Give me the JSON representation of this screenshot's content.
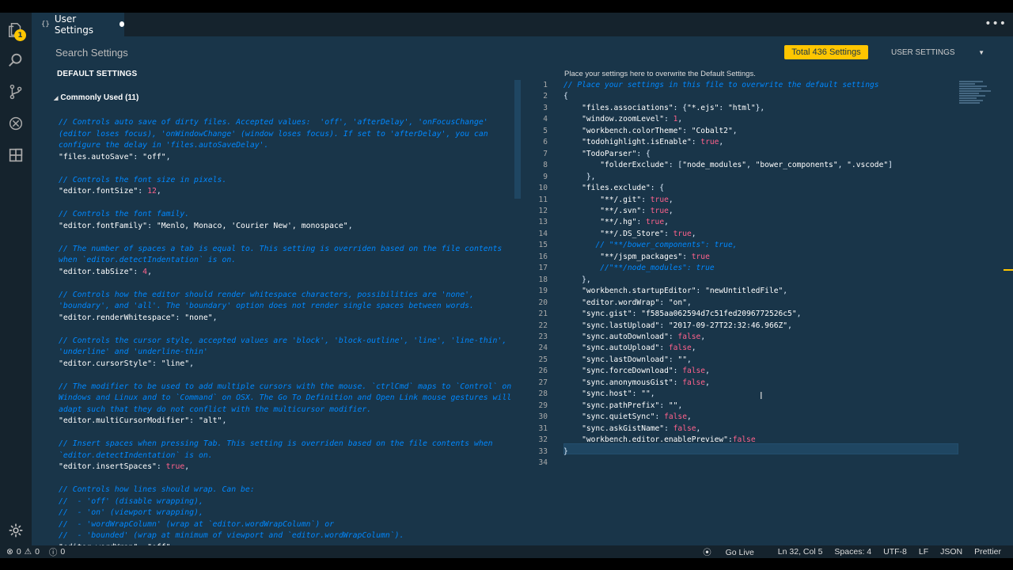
{
  "tab": {
    "label": "User Settings",
    "icon_text": "{}"
  },
  "search": {
    "placeholder": "Search Settings"
  },
  "toolbar": {
    "total_label": "Total 436 Settings",
    "scope_label": "USER SETTINGS"
  },
  "activity_badge": "1",
  "left": {
    "header": "DEFAULT SETTINGS",
    "group_label": "Commonly Used (11)",
    "lines": [
      {
        "t": "cm",
        "v": "// Controls auto save of dirty files. Accepted values:  'off', 'afterDelay', 'onFocusChange'"
      },
      {
        "t": "cm",
        "v": "(editor loses focus), 'onWindowChange' (window loses focus). If set to 'afterDelay', you can"
      },
      {
        "t": "cm",
        "v": "configure the delay in 'files.autoSaveDelay'."
      },
      {
        "t": "kv",
        "k": "\"files.autoSave\"",
        "s": ": ",
        "v": "\"off\"",
        "vt": "p-str",
        "e": ","
      },
      {
        "t": "blank",
        "v": ""
      },
      {
        "t": "cm",
        "v": "// Controls the font size in pixels."
      },
      {
        "t": "kv",
        "k": "\"editor.fontSize\"",
        "s": ": ",
        "v": "12",
        "vt": "num",
        "e": ","
      },
      {
        "t": "blank",
        "v": ""
      },
      {
        "t": "cm",
        "v": "// Controls the font family."
      },
      {
        "t": "kv",
        "k": "\"editor.fontFamily\"",
        "s": ": ",
        "v": "\"Menlo, Monaco, 'Courier New', monospace\"",
        "vt": "p-str",
        "e": ","
      },
      {
        "t": "blank",
        "v": ""
      },
      {
        "t": "cm",
        "v": "// The number of spaces a tab is equal to. This setting is overriden based on the file contents"
      },
      {
        "t": "cm",
        "v": "when `editor.detectIndentation` is on."
      },
      {
        "t": "kv",
        "k": "\"editor.tabSize\"",
        "s": ": ",
        "v": "4",
        "vt": "num",
        "e": ","
      },
      {
        "t": "blank",
        "v": ""
      },
      {
        "t": "cm",
        "v": "// Controls how the editor should render whitespace characters, possibilities are 'none',"
      },
      {
        "t": "cm",
        "v": "'boundary', and 'all'. The 'boundary' option does not render single spaces between words."
      },
      {
        "t": "kv",
        "k": "\"editor.renderWhitespace\"",
        "s": ": ",
        "v": "\"none\"",
        "vt": "p-str",
        "e": ","
      },
      {
        "t": "blank",
        "v": ""
      },
      {
        "t": "cm",
        "v": "// Controls the cursor style, accepted values are 'block', 'block-outline', 'line', 'line-thin',"
      },
      {
        "t": "cm",
        "v": "'underline' and 'underline-thin'"
      },
      {
        "t": "kv",
        "k": "\"editor.cursorStyle\"",
        "s": ": ",
        "v": "\"line\"",
        "vt": "p-str",
        "e": ","
      },
      {
        "t": "blank",
        "v": ""
      },
      {
        "t": "cm",
        "v": "// The modifier to be used to add multiple cursors with the mouse. `ctrlCmd` maps to `Control` on"
      },
      {
        "t": "cm",
        "v": "Windows and Linux and to `Command` on OSX. The Go To Definition and Open Link mouse gestures will"
      },
      {
        "t": "cm",
        "v": "adapt such that they do not conflict with the multicursor modifier."
      },
      {
        "t": "kv",
        "k": "\"editor.multiCursorModifier\"",
        "s": ": ",
        "v": "\"alt\"",
        "vt": "p-str",
        "e": ","
      },
      {
        "t": "blank",
        "v": ""
      },
      {
        "t": "cm",
        "v": "// Insert spaces when pressing Tab. This setting is overriden based on the file contents when"
      },
      {
        "t": "cm",
        "v": "`editor.detectIndentation` is on."
      },
      {
        "t": "kv",
        "k": "\"editor.insertSpaces\"",
        "s": ": ",
        "v": "true",
        "vt": "bool",
        "e": ","
      },
      {
        "t": "blank",
        "v": ""
      },
      {
        "t": "cm",
        "v": "// Controls how lines should wrap. Can be:"
      },
      {
        "t": "cm",
        "v": "//  - 'off' (disable wrapping),"
      },
      {
        "t": "cm",
        "v": "//  - 'on' (viewport wrapping),"
      },
      {
        "t": "cm",
        "v": "//  - 'wordWrapColumn' (wrap at `editor.wordWrapColumn`) or"
      },
      {
        "t": "cm",
        "v": "//  - 'bounded' (wrap at minimum of viewport and `editor.wordWrapColumn`)."
      },
      {
        "t": "kv",
        "k": "\"editor.wordWrap\"",
        "s": ": ",
        "v": "\"off\"",
        "vt": "p-str",
        "e": ","
      }
    ]
  },
  "right": {
    "hint": "Place your settings here to overwrite the Default Settings.",
    "line_numbers": [
      "1",
      "2",
      "3",
      "4",
      "5",
      "6",
      "7",
      "8",
      "9",
      "10",
      "11",
      "12",
      "13",
      "14",
      "15",
      "16",
      "17",
      "18",
      "19",
      "20",
      "21",
      "22",
      "23",
      "24",
      "25",
      "26",
      "27",
      "28",
      "29",
      "30",
      "31",
      "32",
      "33",
      "34"
    ],
    "lines": [
      [
        {
          "c": "cm",
          "v": "// Place your settings in this file to overwrite the default settings"
        }
      ],
      [
        {
          "c": "punc",
          "v": "{"
        }
      ],
      [
        {
          "c": "punc",
          "v": "    "
        },
        {
          "c": "key",
          "v": "\"files.associations\""
        },
        {
          "c": "punc",
          "v": ": {"
        },
        {
          "c": "p-str",
          "v": "\"*.ejs\""
        },
        {
          "c": "punc",
          "v": ": "
        },
        {
          "c": "p-str",
          "v": "\"html\""
        },
        {
          "c": "punc",
          "v": "},"
        }
      ],
      [
        {
          "c": "punc",
          "v": "    "
        },
        {
          "c": "key",
          "v": "\"window.zoomLevel\""
        },
        {
          "c": "punc",
          "v": ": "
        },
        {
          "c": "num",
          "v": "1"
        },
        {
          "c": "punc",
          "v": ","
        }
      ],
      [
        {
          "c": "punc",
          "v": "    "
        },
        {
          "c": "key",
          "v": "\"workbench.colorTheme\""
        },
        {
          "c": "punc",
          "v": ": "
        },
        {
          "c": "p-str",
          "v": "\"Cobalt2\""
        },
        {
          "c": "punc",
          "v": ","
        }
      ],
      [
        {
          "c": "punc",
          "v": "    "
        },
        {
          "c": "key",
          "v": "\"todohighlight.isEnable\""
        },
        {
          "c": "punc",
          "v": ": "
        },
        {
          "c": "bool",
          "v": "true"
        },
        {
          "c": "punc",
          "v": ","
        }
      ],
      [
        {
          "c": "punc",
          "v": "    "
        },
        {
          "c": "key",
          "v": "\"TodoParser\""
        },
        {
          "c": "punc",
          "v": ": {"
        }
      ],
      [
        {
          "c": "punc",
          "v": "        "
        },
        {
          "c": "key",
          "v": "\"folderExclude\""
        },
        {
          "c": "punc",
          "v": ": ["
        },
        {
          "c": "p-str",
          "v": "\"node_modules\""
        },
        {
          "c": "punc",
          "v": ", "
        },
        {
          "c": "p-str",
          "v": "\"bower_components\""
        },
        {
          "c": "punc",
          "v": ", "
        },
        {
          "c": "p-str",
          "v": "\".vscode\""
        },
        {
          "c": "punc",
          "v": "]"
        }
      ],
      [
        {
          "c": "punc",
          "v": "     },"
        }
      ],
      [
        {
          "c": "punc",
          "v": "    "
        },
        {
          "c": "key",
          "v": "\"files.exclude\""
        },
        {
          "c": "punc",
          "v": ": {"
        }
      ],
      [
        {
          "c": "punc",
          "v": "        "
        },
        {
          "c": "key",
          "v": "\"**/.git\""
        },
        {
          "c": "punc",
          "v": ": "
        },
        {
          "c": "bool",
          "v": "true"
        },
        {
          "c": "punc",
          "v": ","
        }
      ],
      [
        {
          "c": "punc",
          "v": "        "
        },
        {
          "c": "key",
          "v": "\"**/.svn\""
        },
        {
          "c": "punc",
          "v": ": "
        },
        {
          "c": "bool",
          "v": "true"
        },
        {
          "c": "punc",
          "v": ","
        }
      ],
      [
        {
          "c": "punc",
          "v": "        "
        },
        {
          "c": "key",
          "v": "\"**/.hg\""
        },
        {
          "c": "punc",
          "v": ": "
        },
        {
          "c": "bool",
          "v": "true"
        },
        {
          "c": "punc",
          "v": ","
        }
      ],
      [
        {
          "c": "punc",
          "v": "        "
        },
        {
          "c": "key",
          "v": "\"**/.DS_Store\""
        },
        {
          "c": "punc",
          "v": ": "
        },
        {
          "c": "bool",
          "v": "true"
        },
        {
          "c": "punc",
          "v": ","
        }
      ],
      [
        {
          "c": "punc",
          "v": "       "
        },
        {
          "c": "cm",
          "v": "// \"**/bower_components\": true,"
        }
      ],
      [
        {
          "c": "punc",
          "v": "        "
        },
        {
          "c": "key",
          "v": "\"**/jspm_packages\""
        },
        {
          "c": "punc",
          "v": ": "
        },
        {
          "c": "bool",
          "v": "true"
        }
      ],
      [
        {
          "c": "punc",
          "v": "        "
        },
        {
          "c": "cm",
          "v": "//\"**/node_modules\": true"
        }
      ],
      [
        {
          "c": "punc",
          "v": "    },"
        }
      ],
      [
        {
          "c": "punc",
          "v": "    "
        },
        {
          "c": "key",
          "v": "\"workbench.startupEditor\""
        },
        {
          "c": "punc",
          "v": ": "
        },
        {
          "c": "p-str",
          "v": "\"newUntitledFile\""
        },
        {
          "c": "punc",
          "v": ","
        }
      ],
      [
        {
          "c": "punc",
          "v": "    "
        },
        {
          "c": "key",
          "v": "\"editor.wordWrap\""
        },
        {
          "c": "punc",
          "v": ": "
        },
        {
          "c": "p-str",
          "v": "\"on\""
        },
        {
          "c": "punc",
          "v": ","
        }
      ],
      [
        {
          "c": "punc",
          "v": "    "
        },
        {
          "c": "key",
          "v": "\"sync.gist\""
        },
        {
          "c": "punc",
          "v": ": "
        },
        {
          "c": "p-str",
          "v": "\"f585aa062594d7c51fed2096772526c5\""
        },
        {
          "c": "punc",
          "v": ","
        }
      ],
      [
        {
          "c": "punc",
          "v": "    "
        },
        {
          "c": "key",
          "v": "\"sync.lastUpload\""
        },
        {
          "c": "punc",
          "v": ": "
        },
        {
          "c": "p-str",
          "v": "\"2017-09-27T22:32:46.966Z\""
        },
        {
          "c": "punc",
          "v": ","
        }
      ],
      [
        {
          "c": "punc",
          "v": "    "
        },
        {
          "c": "key",
          "v": "\"sync.autoDownload\""
        },
        {
          "c": "punc",
          "v": ": "
        },
        {
          "c": "bool",
          "v": "false"
        },
        {
          "c": "punc",
          "v": ","
        }
      ],
      [
        {
          "c": "punc",
          "v": "    "
        },
        {
          "c": "key",
          "v": "\"sync.autoUpload\""
        },
        {
          "c": "punc",
          "v": ": "
        },
        {
          "c": "bool",
          "v": "false"
        },
        {
          "c": "punc",
          "v": ","
        }
      ],
      [
        {
          "c": "punc",
          "v": "    "
        },
        {
          "c": "key",
          "v": "\"sync.lastDownload\""
        },
        {
          "c": "punc",
          "v": ": "
        },
        {
          "c": "p-str",
          "v": "\"\""
        },
        {
          "c": "punc",
          "v": ","
        }
      ],
      [
        {
          "c": "punc",
          "v": "    "
        },
        {
          "c": "key",
          "v": "\"sync.forceDownload\""
        },
        {
          "c": "punc",
          "v": ": "
        },
        {
          "c": "bool",
          "v": "false"
        },
        {
          "c": "punc",
          "v": ","
        }
      ],
      [
        {
          "c": "punc",
          "v": "    "
        },
        {
          "c": "key",
          "v": "\"sync.anonymousGist\""
        },
        {
          "c": "punc",
          "v": ": "
        },
        {
          "c": "bool",
          "v": "false"
        },
        {
          "c": "punc",
          "v": ","
        }
      ],
      [
        {
          "c": "punc",
          "v": "    "
        },
        {
          "c": "key",
          "v": "\"sync.host\""
        },
        {
          "c": "punc",
          "v": ": "
        },
        {
          "c": "p-str",
          "v": "\"\""
        },
        {
          "c": "punc",
          "v": ","
        }
      ],
      [
        {
          "c": "punc",
          "v": "    "
        },
        {
          "c": "key",
          "v": "\"sync.pathPrefix\""
        },
        {
          "c": "punc",
          "v": ": "
        },
        {
          "c": "p-str",
          "v": "\"\""
        },
        {
          "c": "punc",
          "v": ","
        }
      ],
      [
        {
          "c": "punc",
          "v": "    "
        },
        {
          "c": "key",
          "v": "\"sync.quietSync\""
        },
        {
          "c": "punc",
          "v": ": "
        },
        {
          "c": "bool",
          "v": "false"
        },
        {
          "c": "punc",
          "v": ","
        }
      ],
      [
        {
          "c": "punc",
          "v": "    "
        },
        {
          "c": "key",
          "v": "\"sync.askGistName\""
        },
        {
          "c": "punc",
          "v": ": "
        },
        {
          "c": "bool",
          "v": "false"
        },
        {
          "c": "punc",
          "v": ","
        }
      ],
      [
        {
          "c": "punc",
          "v": "    "
        },
        {
          "c": "key",
          "v": "\"workbench.editor.enablePreview\""
        },
        {
          "c": "punc",
          "v": ":"
        },
        {
          "c": "bool",
          "v": "false"
        }
      ],
      [
        {
          "c": "punc",
          "v": "}"
        }
      ],
      [
        {
          "c": "punc",
          "v": ""
        }
      ]
    ]
  },
  "status": {
    "errors": "0",
    "warnings": "0",
    "infos": "0",
    "go_live": "Go Live",
    "position": "Ln 32, Col 5",
    "spaces": "Spaces: 4",
    "encoding": "UTF-8",
    "eol": "LF",
    "language": "JSON",
    "formatter": "Prettier"
  },
  "colors": {
    "background": "#193549",
    "panel": "#15232d",
    "accent": "#ffc600",
    "comment": "#0088ff",
    "string": "#ffffff",
    "number": "#ff628c"
  },
  "icons": [
    "explorer-icon",
    "search-icon",
    "source-control-icon",
    "debug-icon",
    "extensions-icon",
    "gear-icon",
    "more-icon",
    "go-live-icon",
    "error-icon",
    "warning-icon",
    "info-icon"
  ]
}
